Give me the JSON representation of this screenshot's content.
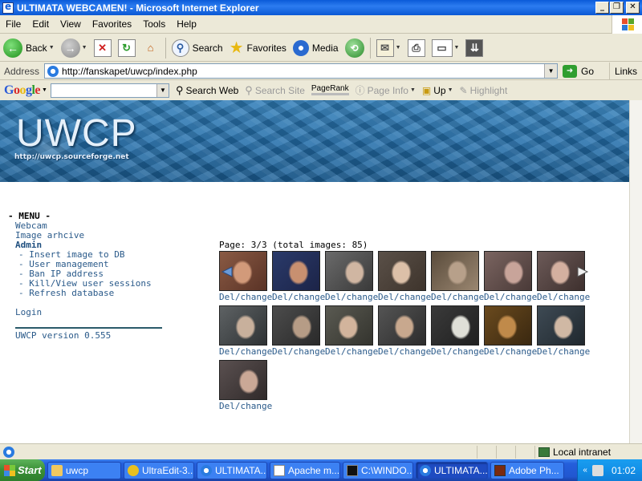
{
  "window": {
    "title": "ULTIMATA WEBCAMEN! - Microsoft Internet Explorer"
  },
  "menubar": {
    "items": [
      "File",
      "Edit",
      "View",
      "Favorites",
      "Tools",
      "Help"
    ]
  },
  "toolbar": {
    "back_label": "Back",
    "search_label": "Search",
    "favorites_label": "Favorites",
    "media_label": "Media"
  },
  "address": {
    "label": "Address",
    "url": "http://fanskapet/uwcp/index.php",
    "go_label": "Go",
    "links_label": "Links"
  },
  "googlebar": {
    "logo": "Google",
    "search_web": "Search Web",
    "search_site": "Search Site",
    "pagerank": "PageRank",
    "page_info": "Page Info",
    "up": "Up",
    "highlight": "Highlight"
  },
  "banner": {
    "title": "UWCP",
    "url": "http://uwcp.sourceforge.net"
  },
  "menu": {
    "header": "- MENU -",
    "webcam": "Webcam",
    "archive": "Image arhcive",
    "admin": "Admin",
    "admin_items": [
      "- Insert image to DB",
      "- User management",
      "- Ban IP address",
      "- Kill/View user sessions",
      "- Refresh database"
    ],
    "login": "Login",
    "version": "UWCP version 0.555"
  },
  "gallery": {
    "page_info": "Page: 3/3 (total images: 85)",
    "link_label": "Del/change",
    "thumbnails": [
      {
        "palette": [
          "#8a5a44",
          "#d29a7a",
          "#5a3326"
        ]
      },
      {
        "palette": [
          "#2a3a6a",
          "#c89070",
          "#1c2448"
        ]
      },
      {
        "palette": [
          "#6a6a6a",
          "#d0b6a2",
          "#3a3a3a"
        ]
      },
      {
        "palette": [
          "#5a5048",
          "#dcc0a8",
          "#3e342c"
        ]
      },
      {
        "palette": [
          "#5a4c3c",
          "#b7a08a",
          "#9a8670"
        ]
      },
      {
        "palette": [
          "#7a6460",
          "#c8a49a",
          "#4a3a38"
        ]
      },
      {
        "palette": [
          "#6c5a58",
          "#d4b0a0",
          "#3e302e"
        ]
      },
      {
        "palette": [
          "#5e6264",
          "#c8b09c",
          "#2e3234"
        ]
      },
      {
        "palette": [
          "#4c4c4c",
          "#b69c86",
          "#2a2a2a"
        ]
      },
      {
        "palette": [
          "#5a5a52",
          "#d2b49c",
          "#34342e"
        ]
      },
      {
        "palette": [
          "#545454",
          "#c8a88e",
          "#2c2c2c"
        ]
      },
      {
        "palette": [
          "#3a3a3a",
          "#e0e0d8",
          "#202020"
        ]
      },
      {
        "palette": [
          "#6a4a1e",
          "#c08a4a",
          "#3a2810"
        ]
      },
      {
        "palette": [
          "#3e4a54",
          "#d0b8a4",
          "#20282e"
        ]
      },
      {
        "palette": [
          "#5a5050",
          "#caa896",
          "#302a2a"
        ]
      }
    ]
  },
  "statusbar": {
    "zone": "Local intranet"
  },
  "taskbar": {
    "start": "Start",
    "tasks": [
      {
        "label": "uwcp",
        "active": false
      },
      {
        "label": "UltraEdit-3...",
        "active": false
      },
      {
        "label": "ULTIMATA...",
        "active": false
      },
      {
        "label": "Apache m...",
        "active": false
      },
      {
        "label": "C:\\WINDO...",
        "active": false
      },
      {
        "label": "ULTIMATA...",
        "active": true
      },
      {
        "label": "Adobe Ph...",
        "active": false
      }
    ],
    "clock": "01:02"
  },
  "colors": {
    "link": "#2a5a8a",
    "banner": "#246fab",
    "titlebar": "#0a5ad8"
  }
}
